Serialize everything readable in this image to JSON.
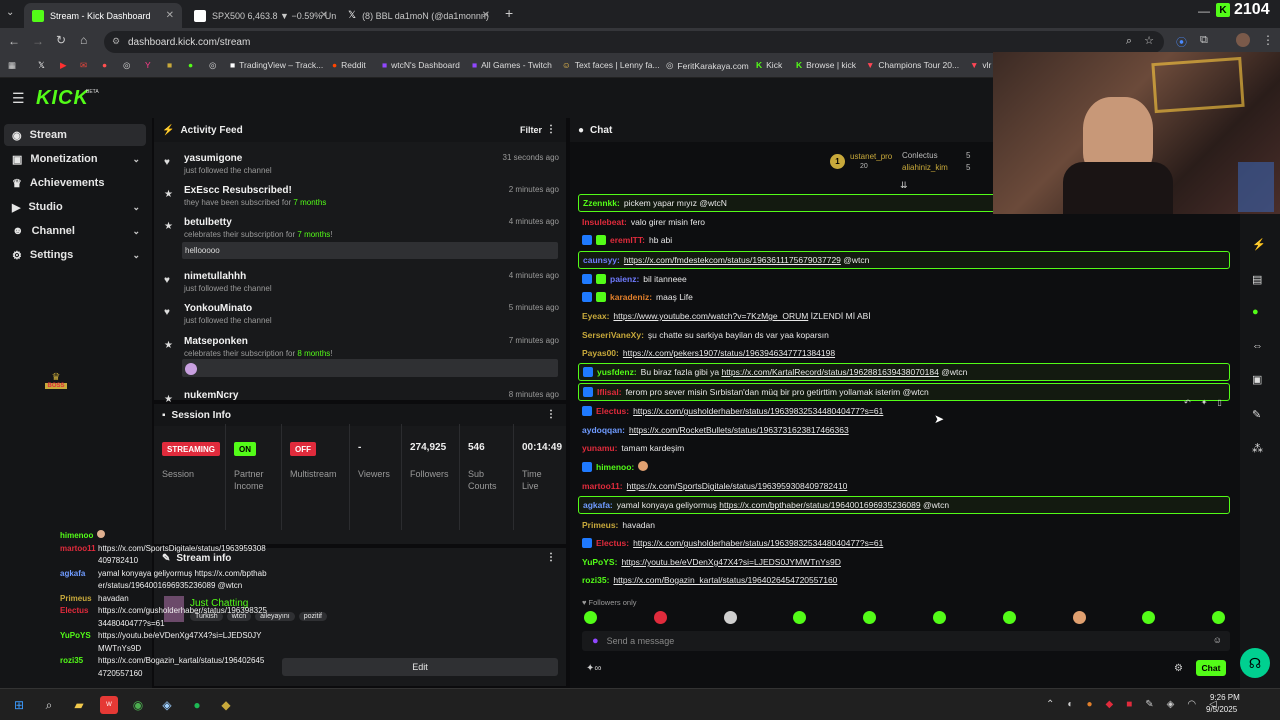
{
  "browser": {
    "tabs": [
      {
        "title": "Stream - Kick Dashboard",
        "active": true
      },
      {
        "title": "SPX500 6,463.8 ▼ −0.59% Unn",
        "active": false
      },
      {
        "title": "(8) BBL da1moN (@da1monnn)",
        "active": false
      }
    ],
    "new_tab": "+",
    "url": "dashboard.kick.com/stream",
    "bookmarks": [
      "TradingView – Track...",
      "Reddit",
      "wtcN's Dashboard",
      "All Games - Twitch",
      "Text faces | Lenny fa...",
      "FeritKarakaya.com",
      "Kick",
      "Browse | kick",
      "Champions Tour 20...",
      "vlr"
    ],
    "window_min": "—",
    "window_num": "2104"
  },
  "kick": {
    "logo": "KICK",
    "logo_beta": "BETA"
  },
  "sidebar": {
    "items": [
      {
        "label": "Stream",
        "icon": "broadcast-icon",
        "active": true,
        "has_chevron": false
      },
      {
        "label": "Monetization",
        "icon": "money-icon",
        "active": false,
        "has_chevron": true
      },
      {
        "label": "Achievements",
        "icon": "trophy-icon",
        "active": false,
        "has_chevron": false
      },
      {
        "label": "Studio",
        "icon": "studio-icon",
        "active": false,
        "has_chevron": true
      },
      {
        "label": "Channel",
        "icon": "user-icon",
        "active": false,
        "has_chevron": true
      },
      {
        "label": "Settings",
        "icon": "gear-icon",
        "active": false,
        "has_chevron": true
      }
    ],
    "boss_label": "BOSS"
  },
  "activity_feed": {
    "title": "Activity Feed",
    "filter": "Filter",
    "items": [
      {
        "icon": "heart-icon",
        "name": "yasumigone",
        "sub": "just followed the channel",
        "time": "31 seconds ago"
      },
      {
        "icon": "star-icon",
        "name": "ExEscc Resubscribed!",
        "sub_pre": "they have been subscribed for ",
        "sub_hl": "7 months",
        "sub_post": "",
        "time": "2 minutes ago"
      },
      {
        "icon": "star-icon",
        "name": "betulbetty",
        "sub_pre": "celebrates their subscription for ",
        "sub_hl": "7 months",
        "sub_post": "!",
        "time": "4 minutes ago",
        "message": "hellooooo"
      },
      {
        "icon": "heart-icon",
        "name": "nimetullahhh",
        "sub": "just followed the channel",
        "time": "4 minutes ago"
      },
      {
        "icon": "heart-icon",
        "name": "YonkouMinato",
        "sub": "just followed the channel",
        "time": "5 minutes ago"
      },
      {
        "icon": "star-icon",
        "name": "Matseponken",
        "sub_pre": "celebrates their subscription for ",
        "sub_hl": "8 months",
        "sub_post": "!",
        "time": "7 minutes ago"
      },
      {
        "icon": "star-icon",
        "name": "nukemNcry",
        "time": "8 minutes ago"
      }
    ]
  },
  "session_info": {
    "title": "Session Info",
    "cells": [
      {
        "badge": "STREAMING",
        "badge_color": "#e02b3c",
        "label": "Session"
      },
      {
        "badge": "ON",
        "badge_color": "#53fc18",
        "label": "Partner Income"
      },
      {
        "badge": "OFF",
        "badge_color": "#e02b3c",
        "label": "Multistream"
      },
      {
        "value": "-",
        "label": "Viewers"
      },
      {
        "value": "274,925",
        "label": "Followers"
      },
      {
        "value": "546",
        "label": "Sub Counts"
      },
      {
        "value": "00:14:49",
        "label": "Time Live"
      }
    ]
  },
  "stream_info": {
    "title": "Stream info",
    "category": "Just Chatting",
    "tags": [
      "Turkish",
      "wtcn",
      "aileyayını",
      "pozitif"
    ],
    "edit": "Edit"
  },
  "chat": {
    "title": "Chat",
    "leaderboard": {
      "rank": "1",
      "first_name": "ustanet_pro",
      "first_count": "20",
      "second_name": "Conlectus",
      "second_count": "5",
      "third_name": "aliahiniz_kim",
      "third_count": "5"
    },
    "messages": [
      {
        "user": "Zzennkk",
        "color": "#53fc18",
        "text": "pickem yapar mıyız @wtcN",
        "highlight": true
      },
      {
        "user": "Insulebeat",
        "color": "#e02b3c",
        "text": "valo girer misin fero"
      },
      {
        "user": "eremITT",
        "color": "#e02b3c",
        "text": "hb abi",
        "badges": 2
      },
      {
        "user": "caunsyy",
        "color": "#6f7bff",
        "link": "https://x.com/fmdestekcom/status/1963611175679037729",
        "after": " @wtcn",
        "highlight": true
      },
      {
        "user": "paienz",
        "color": "#6f7bff",
        "text": "bil itanneee",
        "badges": 2
      },
      {
        "user": "karadeniz",
        "color": "#e07f2b",
        "text": "maaş Life",
        "badges": 2
      },
      {
        "user": "Eyeax",
        "color": "#c8a93b",
        "link": "https://www.youtube.com/watch?v=7KzMge_ORUM",
        "after": " İZLENDİ Mİ ABİ"
      },
      {
        "user": "SerseriVaneXy",
        "color": "#c8a93b",
        "text": "şu chatte su sarkiya bayilan ds var yaa koparsın"
      },
      {
        "user": "Payas00",
        "color": "#c8a93b",
        "link": "https://x.com/pekers1907/status/1963946347771384198"
      },
      {
        "user": "yusfdenz",
        "color": "#53fc18",
        "text": "Bu biraz fazla gibi ya ",
        "link": "https://x.com/KartalRecord/status/1962881639438070184",
        "after": " @wtcn",
        "highlight": true,
        "badges": 1
      },
      {
        "user": "Iflisal",
        "color": "#e02b3c",
        "text": "ferom pro sever misin Sırbistan'dan müq bir pro getirttim yollamak isterim @wtcn",
        "highlight": true,
        "badges": 1
      },
      {
        "user": "Electus",
        "color": "#e02b3c",
        "link": "https://x.com/gusholderhaber/status/1963983253448040477?s=61",
        "badges": 1
      },
      {
        "user": "aydoqqan",
        "color": "#6f9bff",
        "link": "https://x.com/RocketBullets/status/1963731623817466363"
      },
      {
        "user": "yunamu",
        "color": "#e02b3c",
        "text": "tamam kardeşim"
      },
      {
        "user": "himenoo",
        "color": "#53fc18",
        "text": "",
        "emote": true,
        "badges": 1
      },
      {
        "user": "martoo11",
        "color": "#e02b3c",
        "link": "https://x.com/SportsDigitale/status/1963959308409782410"
      },
      {
        "user": "agkafa",
        "color": "#6f9bff",
        "text": "yamal konyaya geliyormuş ",
        "link": "https://x.com/bpthaber/status/1964001696935236089",
        "after": " @wtcn",
        "highlight": true
      },
      {
        "user": "Primeus",
        "color": "#c8a93b",
        "text": "havadan"
      },
      {
        "user": "Electus",
        "color": "#e02b3c",
        "link": "https://x.com/gusholderhaber/status/1963983253448040477?s=61",
        "badges": 1
      },
      {
        "user": "YuPoYS",
        "color": "#53fc18",
        "link": "https://youtu.be/eVDenXg47X4?si=LJEDS0JYMWTnYs9D"
      },
      {
        "user": "rozi35",
        "color": "#53fc18",
        "link": "https://x.com/Bogazin_kartal/status/1964026454720557160"
      }
    ],
    "followers_only": "Followers only",
    "input_placeholder": "Send a message",
    "send": "Chat"
  },
  "overlay_chat": {
    "lines": [
      {
        "user": "himenoo",
        "color": "#53fc18",
        "text": ""
      },
      {
        "user": "martoo11",
        "color": "#e02b3c",
        "text": "https://x.com/SportsDigitale/status/1963959308409782410"
      },
      {
        "user": "agkafa",
        "color": "#6f9bff",
        "text": "yamal konyaya geliyormuş https://x.com/bpthaber/status/1964001696935236089 @wtcn"
      },
      {
        "user": "Primeus",
        "color": "#c8a93b",
        "text": "havadan"
      },
      {
        "user": "Electus",
        "color": "#e02b3c",
        "text": "https://x.com/gusholderhaber/status/1963983253448040477?s=61"
      },
      {
        "user": "YuPoYS",
        "color": "#53fc18",
        "text": "https://youtu.be/eVDenXg47X4?si=LJEDS0JYMWTnYs9D"
      },
      {
        "user": "rozi35",
        "color": "#53fc18",
        "text": "https://x.com/Bogazin_kartal/status/1964026454720557160"
      }
    ]
  },
  "taskbar": {
    "time": "9:26 PM",
    "date": "9/5/2025"
  },
  "colors": {
    "kick_green": "#53fc18",
    "red": "#e02b3c"
  }
}
